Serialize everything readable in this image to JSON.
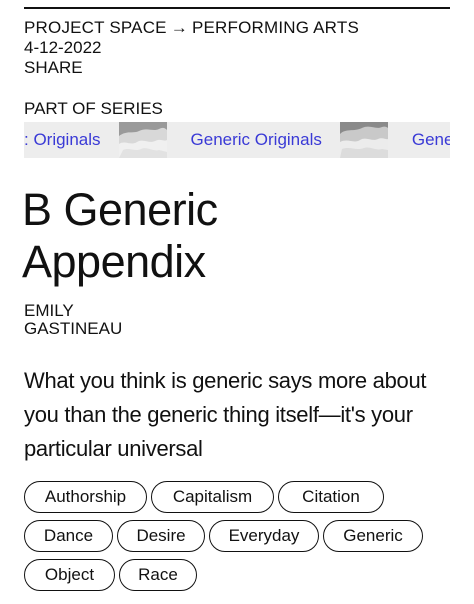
{
  "breadcrumb": {
    "section": "PROJECT SPACE",
    "arrow": "→",
    "subsection": "PERFORMING ARTS"
  },
  "date": "4-12-2022",
  "share_label": "SHARE",
  "series": {
    "label": "PART OF SERIES",
    "name_fragment_left": ": Originals",
    "name": "Generic Originals",
    "name_fragment_right": "Gene"
  },
  "article": {
    "title_line1": "B Generic",
    "title_line2": "Appendix",
    "author_line1": "EMILY",
    "author_line2": "GASTINEAU",
    "summary": "What you think is generic says more about you than the generic thing itself—it's your particular universal"
  },
  "tags": [
    [
      "Authorship",
      "Capitalism",
      "Citation"
    ],
    [
      "Dance",
      "Desire",
      "Everyday",
      "Generic"
    ],
    [
      "Object",
      "Race"
    ]
  ],
  "colors": {
    "accent_link": "#3a3ad6",
    "text": "#111111",
    "marquee_bg": "#ededed"
  }
}
